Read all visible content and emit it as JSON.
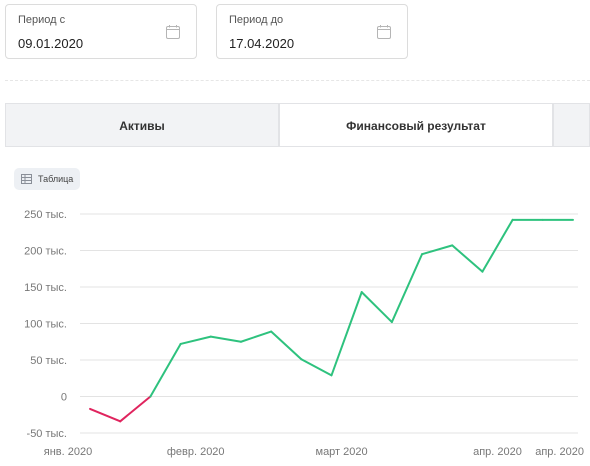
{
  "filters": {
    "date_from": {
      "label": "Период с",
      "value": "09.01.2020",
      "icon": "calendar-icon"
    },
    "date_to": {
      "label": "Период до",
      "value": "17.04.2020",
      "icon": "calendar-icon"
    }
  },
  "tabs": [
    {
      "label": "Активы",
      "active": false
    },
    {
      "label": "Финансовый результат",
      "active": true
    },
    {
      "label": "",
      "active": false
    }
  ],
  "table_toggle": {
    "label": "Таблица",
    "icon": "table-icon"
  },
  "colors": {
    "positive": "#2ec27e",
    "negative": "#e0245e",
    "grid": "#e3e3e3"
  },
  "chart_data": {
    "type": "line",
    "title": "",
    "xlabel": "",
    "ylabel": "",
    "y_tick_labels": [
      "-50 тыс.",
      "0",
      "50 тыс.",
      "100 тыс.",
      "150 тыс.",
      "200 тыс.",
      "250 тыс."
    ],
    "y_ticks": [
      -50000,
      0,
      50000,
      100000,
      150000,
      200000,
      250000
    ],
    "ylim": [
      -50000,
      250000
    ],
    "x_tick_labels": [
      "янв. 2020",
      "февр. 2020",
      "март 2020",
      "апр. 2020",
      "апр. 2020"
    ],
    "x_ticks": [
      "2020-01-09",
      "2020-02-01",
      "2020-03-01",
      "2020-04-01",
      "2020-04-17"
    ],
    "xlim": [
      "2020-01-09",
      "2020-04-17"
    ],
    "grid": true,
    "series": [
      {
        "x": [
          "2020-01-11",
          "2020-01-17",
          "2020-01-23",
          "2020-01-29",
          "2020-02-04",
          "2020-02-10",
          "2020-02-16",
          "2020-02-22",
          "2020-02-28",
          "2020-03-05",
          "2020-03-11",
          "2020-03-17",
          "2020-03-23",
          "2020-03-29",
          "2020-04-04",
          "2020-04-10",
          "2020-04-16"
        ],
        "y": [
          -17000,
          -34000,
          0,
          72000,
          82000,
          75000,
          89000,
          51000,
          29000,
          143000,
          102000,
          195000,
          207000,
          171000,
          242000,
          242000,
          242000
        ]
      }
    ]
  }
}
